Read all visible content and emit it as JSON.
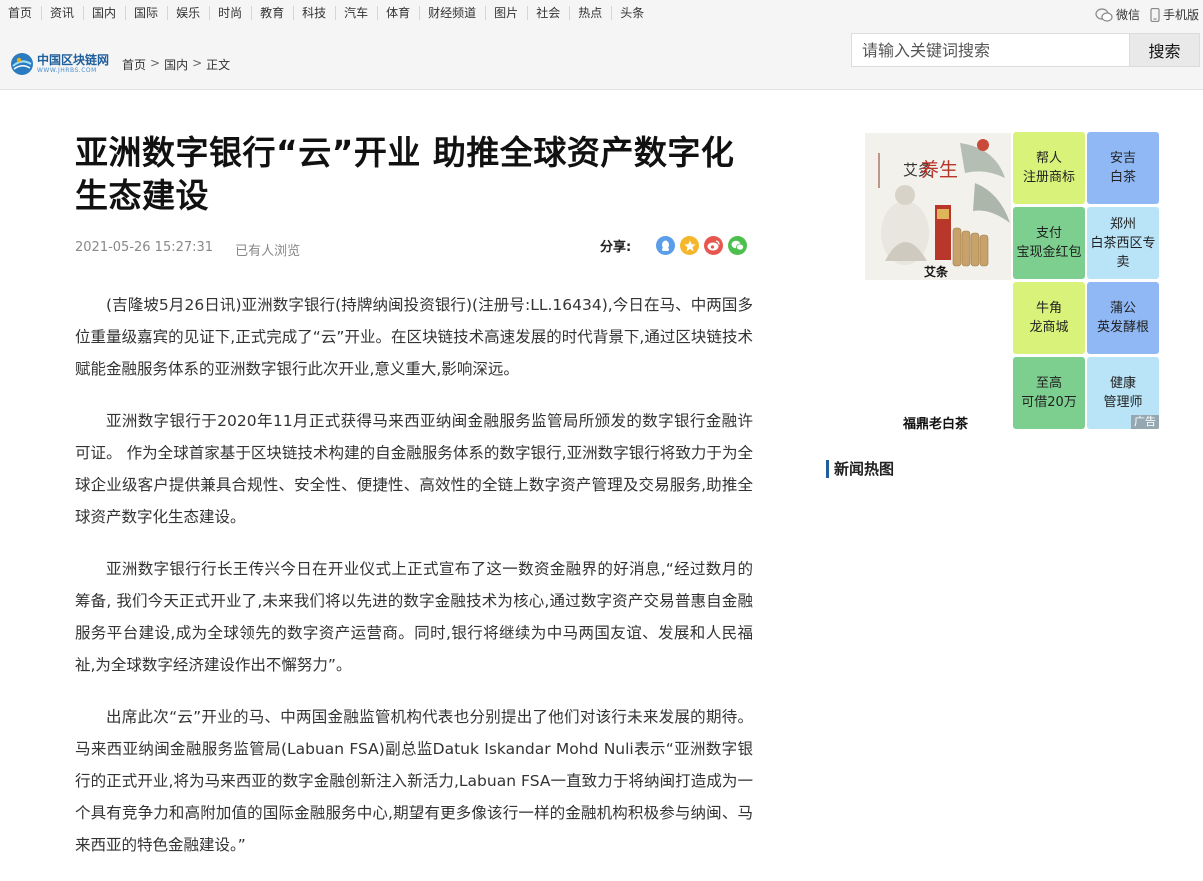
{
  "topnav": [
    "首页",
    "资讯",
    "国内",
    "国际",
    "娱乐",
    "时尚",
    "教育",
    "科技",
    "汽车",
    "体育",
    "财经频道",
    "图片",
    "社会",
    "热点",
    "头条"
  ],
  "topright": {
    "wechat": "微信",
    "mobile": "手机版"
  },
  "logo": {
    "name": "中国区块链网",
    "url_text": "WWW.JHRBS.COM"
  },
  "breadcrumb": {
    "home": "首页",
    "sep": ">",
    "section": "国内",
    "current": "正文"
  },
  "search": {
    "placeholder": "请输入关键词搜索",
    "button": "搜索"
  },
  "article": {
    "title": "亚洲数字银行“云”开业 助推全球资产数字化生态建设",
    "date": "2021-05-26 15:27:31",
    "views": "已有人浏览",
    "share_label": "分享:",
    "paragraphs": [
      "(吉隆坡5月26日讯)亚洲数字银行(持牌纳闽投资银行)(注册号:LL.16434),今日在马、中两国多位重量级嘉宾的见证下,正式完成了“云”开业。在区块链技术高速发展的时代背景下,通过区块链技术赋能金融服务体系的亚洲数字银行此次开业,意义重大,影响深远。",
      "亚洲数字银行于2020年11月正式获得马来西亚纳闽金融服务监管局所颁发的数字银行金融许可证。 作为全球首家基于区块链技术构建的自金融服务体系的数字银行,亚洲数字银行将致力于为全球企业级客户提供兼具合规性、安全性、便捷性、高效性的全链上数字资产管理及交易服务,助推全球资产数字化生态建设。",
      "亚洲数字银行行长王传兴今日在开业仪式上正式宣布了这一数资金融界的好消息,“经过数月的筹备, 我们今天正式开业了,未来我们将以先进的数字金融技术为核心,通过数字资产交易普惠自金融服务平台建设,成为全球领先的数字资产运营商。同时,银行将继续为中马两国友谊、发展和人民福祉,为全球数字经济建设作出不懈努力”。",
      "出席此次“云”开业的马、中两国金融监管机构代表也分别提出了他们对该行未来发展的期待。 马来西亚纳闽金融服务监管局(Labuan FSA)副总监Datuk Iskandar Mohd Nuli表示“亚洲数字银行的正式开业,将为马来西亚的数字金融创新注入新活力,Labuan FSA一直致力于将纳闽打造成为一个具有竞争力和高附加值的国际金融服务中心,期望有更多像该行一样的金融机构积极参与纳闽、马来西亚的特色金融建设。”"
    ]
  },
  "sidebar": {
    "ad_image": {
      "brand_a": "艾灸",
      "brand_b": "养生",
      "caption": "艾条"
    },
    "ad_caption2": "福鼎老白茶",
    "ad_tiles": [
      {
        "text": "帮人\n注册商标",
        "color": "#d9f27a"
      },
      {
        "text": "安吉\n白茶",
        "color": "#8fb8f5"
      },
      {
        "text": "支付\n宝现金红包",
        "color": "#7ccf8e"
      },
      {
        "text": "郑州\n白茶西区专卖",
        "color": "#b9e3f7"
      },
      {
        "text": "牛角\n龙商城",
        "color": "#d9f27a"
      },
      {
        "text": "蒲公\n英发酵根",
        "color": "#8fb8f5"
      },
      {
        "text": "至高\n可借20万",
        "color": "#7ccf8e"
      },
      {
        "text": "健康\n管理师",
        "color": "#b9e3f7"
      }
    ],
    "ad_label": "广告",
    "hot_title": "新闻热图"
  },
  "colors": {
    "brand": "#1f5f9c",
    "qq": "#5a9de8",
    "qzone": "#f5b62b",
    "weibo": "#e8574f",
    "wechat": "#4cbf4c"
  }
}
